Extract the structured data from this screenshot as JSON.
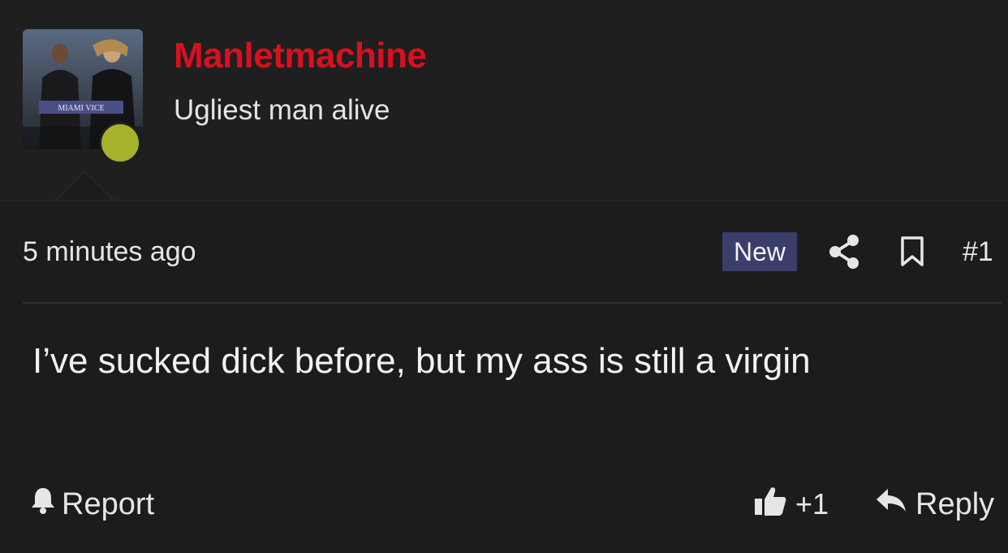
{
  "author": {
    "username": "Manletmachine",
    "user_title": "Ugliest man alive",
    "avatar_caption": "MIAMI VICE",
    "username_color": "#d8101f",
    "online_status_color": "#a5b32c"
  },
  "post": {
    "timestamp": "5 minutes ago",
    "badge": "New",
    "number": "#1",
    "body": "I’ve sucked dick before, but my ass is still a virgin"
  },
  "actions": {
    "report_label": "Report",
    "like_count": "+1",
    "reply_label": "Reply"
  },
  "icons": {
    "share": "share-icon",
    "bookmark": "bookmark-icon",
    "report": "bell-icon",
    "like": "thumbs-up-icon",
    "reply": "reply-arrow-icon"
  }
}
